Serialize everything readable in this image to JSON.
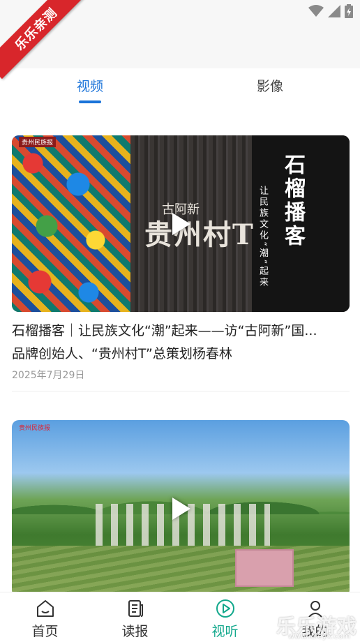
{
  "status_bar": {
    "icons": [
      "wifi-icon",
      "signal-icon",
      "battery-icon"
    ]
  },
  "ribbon": {
    "text": "乐乐亲测"
  },
  "tabs": [
    {
      "label": "视频",
      "active": true
    },
    {
      "label": "影像",
      "active": false
    }
  ],
  "cards": [
    {
      "title_line1": "石榴播客｜让民族文化“潮”起来——访“古阿新”国...",
      "title_line2": "品牌创始人、“贵州村T”总策划杨春林",
      "date": "2025年7月29日",
      "thumb": {
        "side_title": "石榴播客",
        "side_sub": "让民族文化“潮”起来",
        "brand": "贵州村T",
        "brand_sub": "古阿新",
        "badge": "贵州民族报"
      }
    },
    {
      "thumb": {
        "badge": "贵州民族报"
      }
    }
  ],
  "bottom_nav": [
    {
      "label": "首页",
      "icon": "home-icon",
      "active": false
    },
    {
      "label": "读报",
      "icon": "newspaper-icon",
      "active": false
    },
    {
      "label": "视听",
      "icon": "play-circle-icon",
      "active": true
    },
    {
      "label": "我的",
      "icon": "profile-icon",
      "active": false
    }
  ],
  "watermark": {
    "text": "乐乐游戏",
    "url": "www.leleyx.com"
  },
  "colors": {
    "accent": "#1a73d9",
    "nav_active": "#12a88c",
    "ribbon": "#d8262b"
  }
}
